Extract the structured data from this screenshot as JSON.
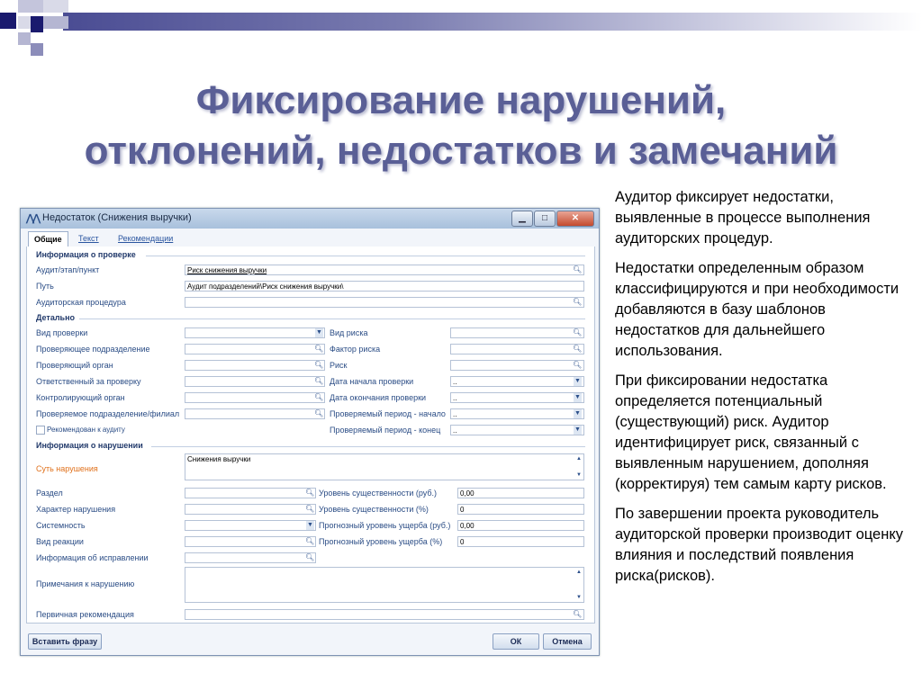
{
  "slide": {
    "title_line1": "Фиксирование нарушений,",
    "title_line2": "отклонений, недостатков и замечаний",
    "paragraphs": [
      "Аудитор фиксирует недостатки, выявленные в процессе выполнения аудиторских процедур.",
      "Недостатки определенным образом классифицируются и при необходимости добавляются в базу шаблонов недостатков для дальнейшего использования.",
      "При фиксировании недостатка определяется потенциальный (существующий) риск. Аудитор идентифицирует риск, связанный с выявленным нарушением, дополняя (корректируя) тем самым карту рисков.",
      " По завершении проекта руководитель аудиторской проверки производит оценку влияния и последствий появления риска(рисков)."
    ]
  },
  "window": {
    "title": "Недостаток (Снижения выручки)",
    "tabs": [
      "Общие",
      "Текст",
      "Рекомендации"
    ],
    "sections": {
      "check_info": "Информация о проверке",
      "details": "Детально",
      "violation_info": "Информация о нарушении"
    },
    "check": {
      "audit_label": "Аудит/этап/пункт",
      "audit_value": "Риск снижения выручки",
      "path_label": "Путь",
      "path_value": "Аудит подразделений\\Риск снижения выручки\\",
      "procedure_label": "Аудиторская процедура",
      "procedure_value": ""
    },
    "details_left": [
      {
        "label": "Вид проверки",
        "value": ""
      },
      {
        "label": "Проверяющее подразделение",
        "value": ""
      },
      {
        "label": "Проверяющий орган",
        "value": ""
      },
      {
        "label": "Ответственный за проверку",
        "value": ""
      },
      {
        "label": "Контролирующий орган",
        "value": ""
      },
      {
        "label": "Проверяемое подразделение/филиал",
        "value": ""
      }
    ],
    "recommended_label": "Рекомендован к аудиту",
    "details_right": [
      {
        "label": "Вид риска",
        "value": ""
      },
      {
        "label": "Фактор риска",
        "value": ""
      },
      {
        "label": "Риск",
        "value": ""
      },
      {
        "label": "Дата начала проверки",
        "value": ".."
      },
      {
        "label": "Дата окончания проверки",
        "value": ".."
      },
      {
        "label": "Проверяемый период - начало",
        "value": ".."
      },
      {
        "label": "Проверяемый период - конец",
        "value": ".."
      }
    ],
    "violation": {
      "essence_label": "Суть нарушения",
      "essence_value": "Снижения выручки",
      "left": [
        {
          "label": "Раздел",
          "value": ""
        },
        {
          "label": "Характер нарушения",
          "value": ""
        },
        {
          "label": "Системность",
          "value": ""
        },
        {
          "label": "Вид реакции",
          "value": ""
        },
        {
          "label": "Информация об исправлении",
          "value": ""
        }
      ],
      "right": [
        {
          "label": "Уровень существенности (руб.)",
          "value": "0,00"
        },
        {
          "label": "Уровень существенности (%)",
          "value": "0"
        },
        {
          "label": "Прогнозный уровень ущерба (руб.)",
          "value": "0,00"
        },
        {
          "label": "Прогнозный уровень ущерба (%)",
          "value": "0"
        }
      ],
      "notes_label": "Примечания к нарушению",
      "primary_rec_label": "Первичная рекомендация"
    },
    "buttons": {
      "insert": "Вставить фразу",
      "ok": "ОК",
      "cancel": "Отмена"
    }
  }
}
